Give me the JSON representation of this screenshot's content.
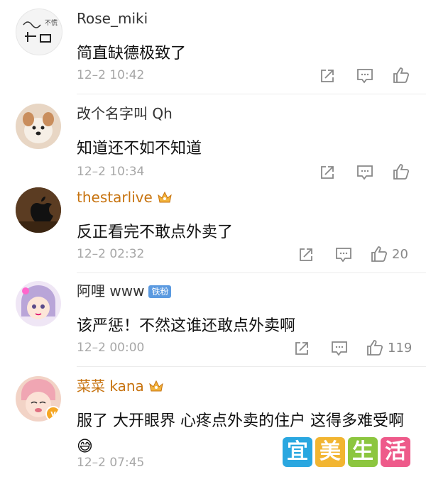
{
  "comments": [
    {
      "username": "Rose_miki",
      "text": "简直缺德极致了",
      "time": "12–2 10:42",
      "likes": ""
    },
    {
      "username": "改个名字叫 Qh",
      "text": "知道还不如不知道",
      "time": "12–2 10:34",
      "likes": ""
    },
    {
      "username": "thestarlive",
      "text": "反正看完不敢点外卖了",
      "time": "12–2 02:32",
      "likes": "20"
    },
    {
      "username": "阿哩 www",
      "badge": "铁粉",
      "text": "该严惩！不然这谁还敢点外卖啊",
      "time": "12–2 00:00",
      "likes": "119"
    },
    {
      "username": "菜菜 kana",
      "text": "服了 大开眼界 心疼点外卖的住户 这得多难受啊😅",
      "time": "12–2 07:45",
      "likes": ""
    }
  ],
  "watermark": [
    "宜",
    "美",
    "生",
    "活"
  ],
  "colors": {
    "vip_name": "#c7730f",
    "normal_name": "#333333",
    "meta": "#a7a7a7",
    "icon": "#888888"
  }
}
